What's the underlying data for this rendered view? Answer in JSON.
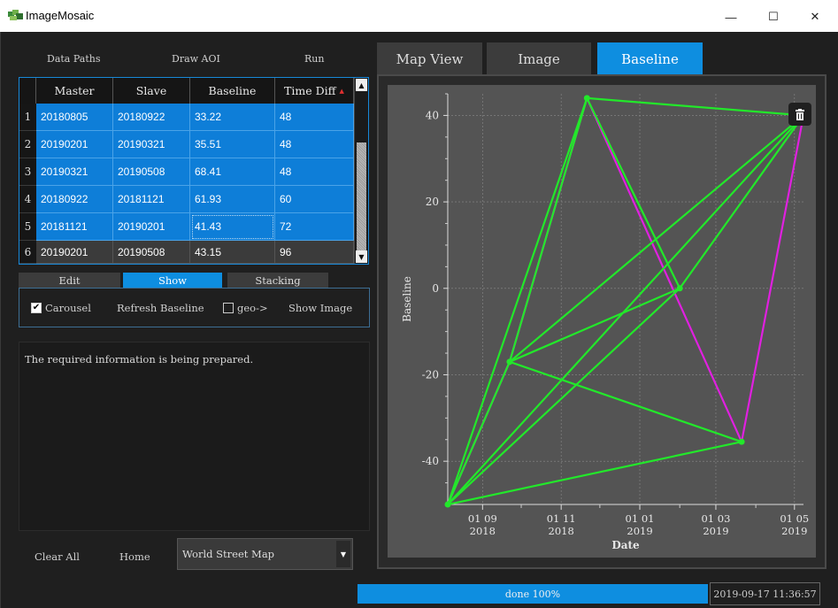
{
  "window": {
    "title": "ImageMosaic",
    "minimize": "—",
    "maximize": "☐",
    "close": "✕",
    "app_icon": "mosaic-app-icon"
  },
  "left_menu": [
    "Data Paths",
    "Draw AOI",
    "Run"
  ],
  "table": {
    "columns": [
      "Master",
      "Slave",
      "Baseline",
      "Time Diff"
    ],
    "sort_indicator": "▲",
    "rows": [
      {
        "n": "1",
        "master": "20180805",
        "slave": "20180922",
        "baseline": "33.22",
        "timediff": "48"
      },
      {
        "n": "2",
        "master": "20190201",
        "slave": "20190321",
        "baseline": "35.51",
        "timediff": "48"
      },
      {
        "n": "3",
        "master": "20190321",
        "slave": "20190508",
        "baseline": "68.41",
        "timediff": "48"
      },
      {
        "n": "4",
        "master": "20180922",
        "slave": "20181121",
        "baseline": "61.93",
        "timediff": "60"
      },
      {
        "n": "5",
        "master": "20181121",
        "slave": "20190201",
        "baseline": "41.43",
        "timediff": "72"
      },
      {
        "n": "6",
        "master": "20190201",
        "slave": "20190508",
        "baseline": "43.15",
        "timediff": "96"
      }
    ]
  },
  "sub_tabs": [
    "Edit",
    "Show",
    "Stacking"
  ],
  "active_sub_tab": "Show",
  "options": {
    "carousel": "Carousel",
    "refresh": "Refresh Baseline",
    "geo": "geo->",
    "show_image": "Show Image"
  },
  "log_text": "The required information is being prepared.",
  "bottom": {
    "clear_all": "Clear All",
    "home": "Home",
    "map_select": "World Street Map"
  },
  "right_tabs": [
    "Map View",
    "Image",
    "Baseline"
  ],
  "active_right_tab": "Baseline",
  "status": {
    "progress_text": "done 100%",
    "progress": 1.0,
    "datetime": "2019-09-17 11:36:57"
  },
  "colors": {
    "accent": "#0e8ee0",
    "connection_green": "#22e82a",
    "connection_magenta": "#e020e0"
  },
  "chart_data": {
    "type": "scatter",
    "xlabel": "Date",
    "ylabel": "Baseline",
    "xlim": [
      "2018-08-05",
      "2019-05-08"
    ],
    "ylim": [
      -50,
      45
    ],
    "y_ticks": [
      40,
      20,
      0,
      -20,
      -40
    ],
    "x_ticks": [
      {
        "date": "2018-09-01",
        "label1": "01 09",
        "label2": "2018"
      },
      {
        "date": "2018-11-01",
        "label1": "01 11",
        "label2": "2018"
      },
      {
        "date": "2019-01-01",
        "label1": "01 01",
        "label2": "2019"
      },
      {
        "date": "2019-03-01",
        "label1": "01 03",
        "label2": "2019"
      },
      {
        "date": "2019-05-01",
        "label1": "01 05",
        "label2": "2019"
      }
    ],
    "grid": true,
    "points": [
      {
        "date": "2018-08-05",
        "baseline": -50
      },
      {
        "date": "2018-09-22",
        "baseline": -17
      },
      {
        "date": "2018-11-21",
        "baseline": 44
      },
      {
        "date": "2019-02-01",
        "baseline": 0
      },
      {
        "date": "2019-03-21",
        "baseline": -35.5
      },
      {
        "date": "2019-05-08",
        "baseline": 40
      }
    ],
    "magenta_links": [
      [
        0,
        1
      ],
      [
        1,
        2
      ],
      [
        2,
        4
      ],
      [
        4,
        5
      ]
    ],
    "green_links": [
      [
        0,
        1
      ],
      [
        0,
        2
      ],
      [
        0,
        3
      ],
      [
        0,
        4
      ],
      [
        0,
        5
      ],
      [
        1,
        2
      ],
      [
        1,
        3
      ],
      [
        1,
        4
      ],
      [
        1,
        5
      ],
      [
        2,
        3
      ],
      [
        2,
        5
      ],
      [
        3,
        5
      ]
    ]
  },
  "icons": {
    "trash": "trash-icon",
    "dropdown": "chevron-down-icon",
    "scroll_up": "scroll-up-icon",
    "scroll_down": "scroll-down-icon"
  }
}
